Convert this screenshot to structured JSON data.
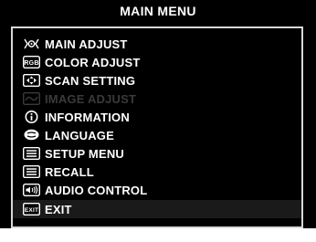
{
  "title": "MAIN MENU",
  "menu": {
    "items": [
      {
        "label": "MAIN ADJUST",
        "icon": "main-adjust-icon",
        "enabled": true
      },
      {
        "label": "COLOR ADJUST",
        "icon": "rgb-icon",
        "enabled": true
      },
      {
        "label": "SCAN SETTING",
        "icon": "scan-setting-icon",
        "enabled": true
      },
      {
        "label": "IMAGE ADJUST",
        "icon": "image-adjust-icon",
        "enabled": false
      },
      {
        "label": "INFORMATION",
        "icon": "information-icon",
        "enabled": true
      },
      {
        "label": "LANGUAGE",
        "icon": "language-icon",
        "enabled": true
      },
      {
        "label": "SETUP MENU",
        "icon": "setup-menu-icon",
        "enabled": true
      },
      {
        "label": "RECALL",
        "icon": "recall-icon",
        "enabled": true
      },
      {
        "label": "AUDIO CONTROL",
        "icon": "audio-control-icon",
        "enabled": true
      },
      {
        "label": "EXIT",
        "icon": "exit-icon",
        "enabled": true
      }
    ]
  },
  "icon_texts": {
    "rgb": "RGB",
    "exit": "EXIT"
  }
}
